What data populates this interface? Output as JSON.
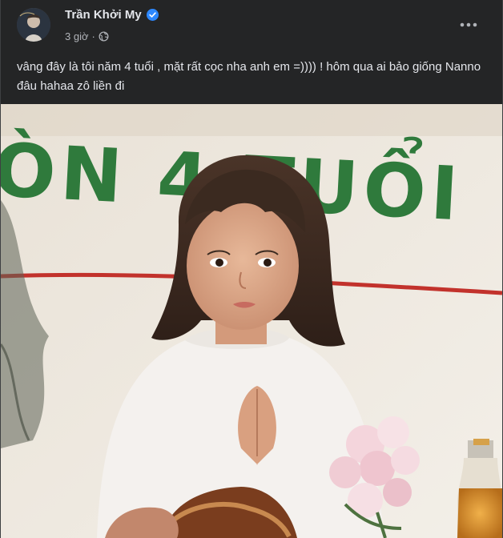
{
  "post": {
    "author": {
      "name": "Trần Khởi My",
      "avatar_icon": "profile-avatar",
      "verified_icon": "verified-badge-icon",
      "verified_color": "#2d88ff"
    },
    "time": "3 giờ",
    "separator": "·",
    "audience_icon": "globe-icon",
    "more_icon": "more-options-icon",
    "text": "vâng đây là tôi năm 4 tuổi , mặt rất cọc nha anh em =)))) ! hôm qua ai bảo giống Nanno đâu hahaa zô liền đi",
    "photo": {
      "banner_text": "ÒN 4 TUỔI",
      "banner_color": "#2f7a3c"
    }
  },
  "theme": {
    "background": "#242526",
    "text_primary": "#e4e6eb",
    "text_secondary": "#b0b3b8"
  }
}
